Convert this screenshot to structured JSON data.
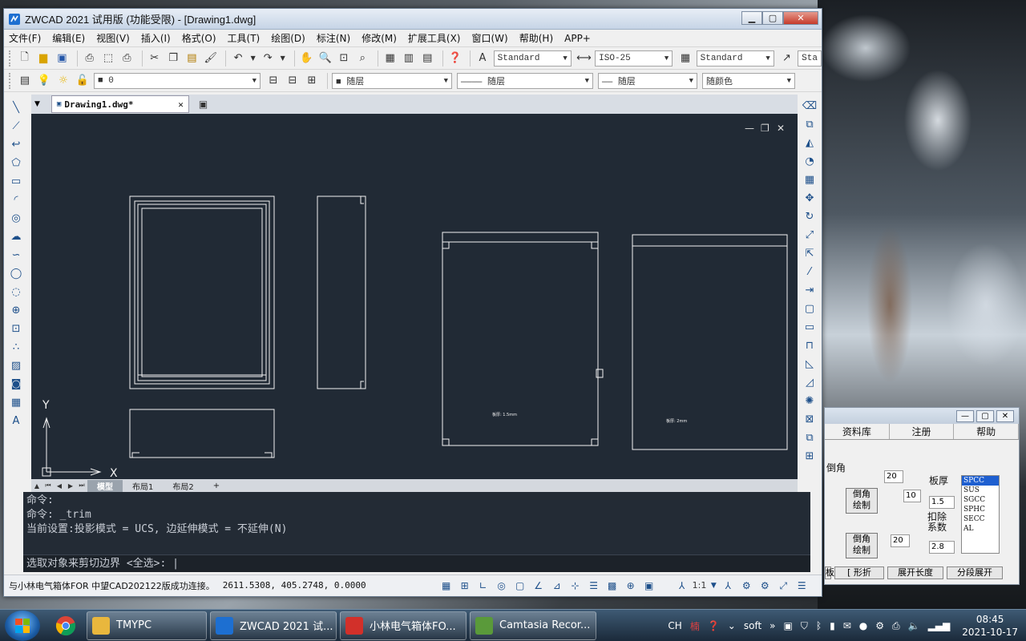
{
  "window": {
    "title": "ZWCAD 2021 试用版 (功能受限) - [Drawing1.dwg]",
    "min": "▁",
    "max": "▢",
    "close": "✕"
  },
  "menu": [
    "文件(F)",
    "编辑(E)",
    "视图(V)",
    "插入(I)",
    "格式(O)",
    "工具(T)",
    "绘图(D)",
    "标注(N)",
    "修改(M)",
    "扩展工具(X)",
    "窗口(W)",
    "帮助(H)",
    "APP+"
  ],
  "toolbar1": {
    "text_style": "Standard",
    "dim_style": "ISO-25",
    "table_style": "Standard",
    "multileader_style": "Sta"
  },
  "toolbar2": {
    "layer": "0",
    "color": "随层",
    "linetype": "随层",
    "lineweight": "随层",
    "plotstyle": "随颜色"
  },
  "doc_tab": {
    "name": "Drawing1.dwg*",
    "close": "✕"
  },
  "viewport_controls": {
    "min": "—",
    "restore": "❐",
    "close": "✕"
  },
  "drawing": {
    "axis_x": "X",
    "axis_y": "Y",
    "note1": "板厚: 1.5mm",
    "note2": "板厚: 2mm"
  },
  "layout_tabs": [
    "模型",
    "布局1",
    "布局2",
    "+"
  ],
  "command": {
    "history": [
      "命令:",
      "命令: _trim",
      "当前设置:投影模式 = UCS, 边延伸模式 = 不延伸(N)"
    ],
    "prompt": "选取对象来剪切边界 <全选>: |"
  },
  "status": {
    "message": "与小林电气箱体FOR 中望CAD202122版成功连接。",
    "coords": "2611.5308, 405.2748, 0.0000",
    "scale": "1:1"
  },
  "plugin": {
    "tabs": [
      "资料库",
      "注册",
      "帮助"
    ],
    "chamfer_label": "倒角",
    "chamfer_btn1": "倒角\n绘制",
    "chamfer_btn2": "倒角\n绘制",
    "val_20a": "20",
    "val_10": "10",
    "val_20b": "20",
    "thickness_label": "板厚",
    "thickness": "1.5",
    "deduct_label": "扣除\n系数",
    "deduct": "2.8",
    "materials": [
      "SPCC",
      "SUS",
      "SGCC",
      "SPHC",
      "SECC",
      "AL"
    ],
    "bottom_buttons": [
      "[ 形折",
      "展开长度",
      "分段展开"
    ],
    "bottom_left": "板",
    "min": "—",
    "max": "▢",
    "close": "✕"
  },
  "taskbar": {
    "tasks": [
      "TMYPC",
      "ZWCAD 2021 试...",
      "小林电气箱体FO...",
      "Camtasia Recor..."
    ],
    "lang": "CH",
    "tray_text": "soft",
    "time": "08:45",
    "date": "2021-10-17"
  }
}
